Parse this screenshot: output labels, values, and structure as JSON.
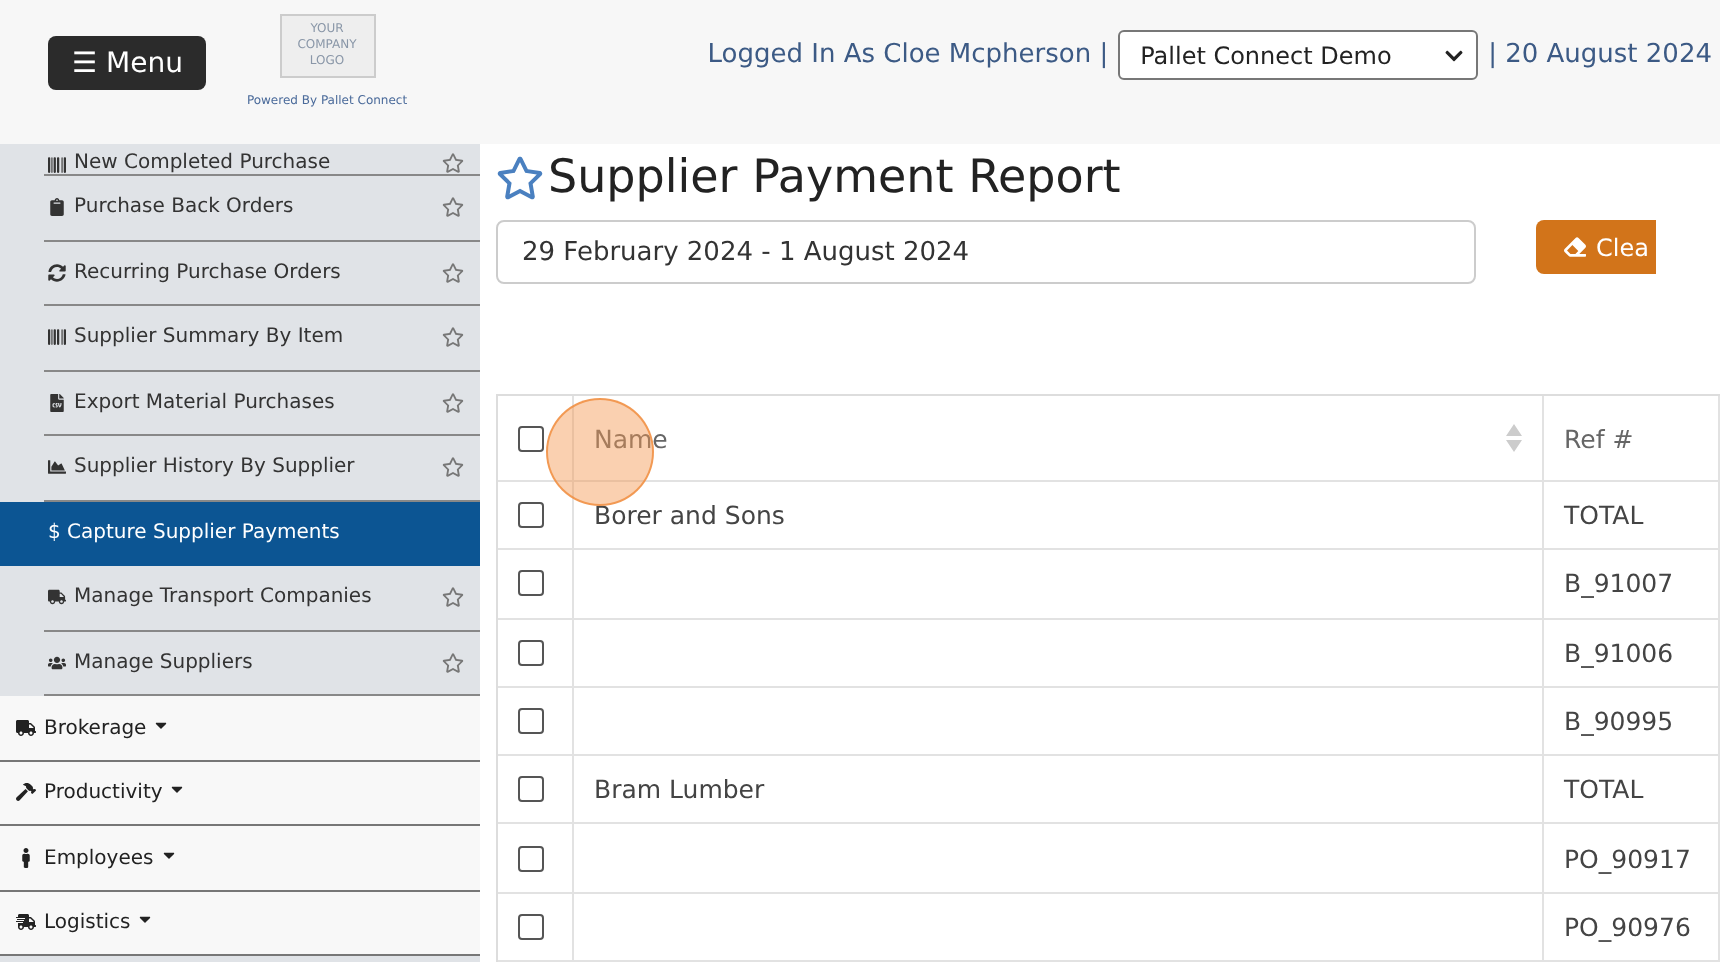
{
  "header": {
    "menu_button": "☰ Menu",
    "logo": {
      "lines": [
        "YOUR",
        "COMPANY",
        "LOGO"
      ],
      "tagline": "Powered By Pallet Connect"
    },
    "logged_in": "Logged In As Cloe Mcpherson |",
    "company_select": "Pallet Connect Demo",
    "date": "| 20 August 2024"
  },
  "sidebar": {
    "items": [
      {
        "kind": "sub",
        "label": "New Completed Purchase",
        "selected": false
      },
      {
        "kind": "sub",
        "label": "Purchase Back Orders",
        "selected": false
      },
      {
        "kind": "sub",
        "label": "Recurring Purchase Orders",
        "selected": false
      },
      {
        "kind": "sub",
        "label": "Supplier Summary By Item",
        "selected": false
      },
      {
        "kind": "sub",
        "label": "Export Material Purchases",
        "selected": false
      },
      {
        "kind": "sub",
        "label": "Supplier History By Supplier",
        "selected": false
      },
      {
        "kind": "sub",
        "label": "$ Capture Supplier Payments",
        "selected": true
      },
      {
        "kind": "sub",
        "label": "Manage Transport Companies",
        "selected": false
      },
      {
        "kind": "sub",
        "label": "Manage Suppliers",
        "selected": false
      },
      {
        "kind": "section",
        "label": "Brokerage"
      },
      {
        "kind": "section",
        "label": "Productivity"
      },
      {
        "kind": "section",
        "label": "Employees"
      },
      {
        "kind": "section",
        "label": "Logistics"
      }
    ]
  },
  "page": {
    "title": "Supplier Payment Report",
    "date_range": "29 February 2024 - 1 August 2024",
    "clear_button": "Clea"
  },
  "table": {
    "columns": [
      "Name",
      "Ref #"
    ],
    "header_checked": false,
    "rows": [
      {
        "name": "Borer and Sons",
        "ref": "TOTAL",
        "checked": false
      },
      {
        "name": "",
        "ref": "B_91007",
        "checked": false
      },
      {
        "name": "",
        "ref": "B_91006",
        "checked": false
      },
      {
        "name": "",
        "ref": "B_90995",
        "checked": false
      },
      {
        "name": "Bram Lumber",
        "ref": "TOTAL",
        "checked": false
      },
      {
        "name": "",
        "ref": "PO_90917",
        "checked": false
      },
      {
        "name": "",
        "ref": "PO_90976",
        "checked": false
      }
    ]
  }
}
